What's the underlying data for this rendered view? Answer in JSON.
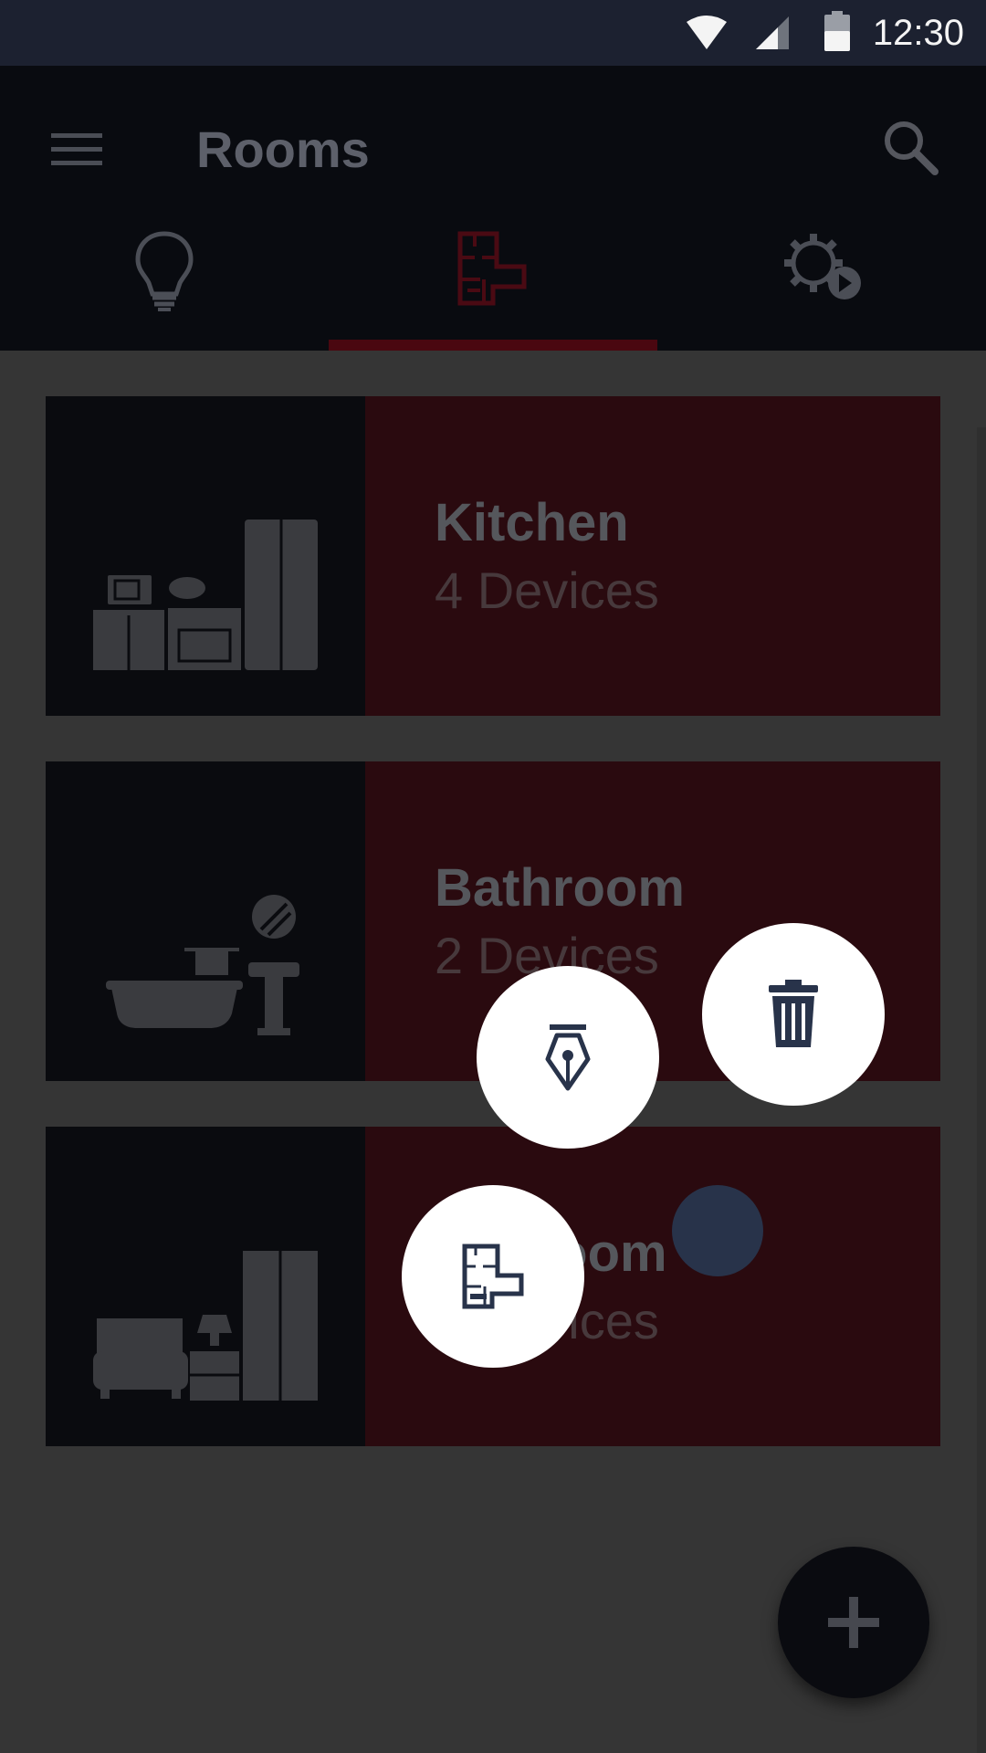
{
  "status_bar": {
    "time": "12:30",
    "icons": [
      "wifi-icon",
      "signal-icon",
      "battery-icon"
    ]
  },
  "app_bar": {
    "title": "Rooms",
    "menu_icon": "menu-icon",
    "search_icon": "search-icon"
  },
  "tabs": [
    {
      "name": "lights",
      "icon": "lightbulb-icon",
      "selected": false
    },
    {
      "name": "rooms",
      "icon": "floorplan-icon",
      "selected": true
    },
    {
      "name": "scenes",
      "icon": "gear-play-icon",
      "selected": false
    }
  ],
  "rooms": [
    {
      "name": "Kitchen",
      "devices": "4 Devices",
      "icon": "kitchen-icon"
    },
    {
      "name": "Bathroom",
      "devices": "2 Devices",
      "icon": "bathroom-icon"
    },
    {
      "name": "Bedroom",
      "devices": "3 Devices",
      "icon": "bedroom-icon"
    }
  ],
  "fab_menu": {
    "actions": [
      {
        "name": "edit",
        "icon": "pen-nib-icon"
      },
      {
        "name": "delete",
        "icon": "trash-icon"
      },
      {
        "name": "add-room",
        "icon": "floorplan-icon"
      }
    ],
    "main_icon": "plus-icon"
  },
  "colors": {
    "status_bar": "#1c2130",
    "app_bar": "#090b10",
    "accent": "#7a0f1c",
    "card": "#2a0a0f",
    "fab_icon": "#28334a"
  }
}
